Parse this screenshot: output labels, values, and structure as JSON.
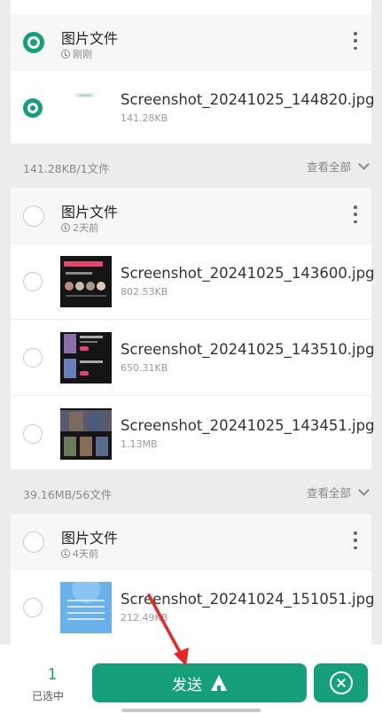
{
  "colors": {
    "accent": "#159f7b",
    "arrow": "#e8262a"
  },
  "groups": [
    {
      "title": "图片文件",
      "time": "刚刚",
      "checked": true,
      "files": [
        {
          "name": "Screenshot_20241025_144820.jpg",
          "size": "141.28KB",
          "checked": true
        }
      ],
      "summary": {
        "stats": "141.28KB/1文件",
        "view_all": "查看全部"
      }
    },
    {
      "title": "图片文件",
      "time": "2天前",
      "checked": false,
      "files": [
        {
          "name": "Screenshot_20241025_143600.jpg",
          "size": "802.53KB",
          "checked": false
        },
        {
          "name": "Screenshot_20241025_143510.jpg",
          "size": "650.31KB",
          "checked": false
        },
        {
          "name": "Screenshot_20241025_143451.jpg",
          "size": "1.13MB",
          "checked": false
        }
      ],
      "summary": {
        "stats": "39.16MB/56文件",
        "view_all": "查看全部"
      }
    },
    {
      "title": "图片文件",
      "time": "4天前",
      "checked": false,
      "files": [
        {
          "name": "Screenshot_20241024_151051.jpg",
          "size": "212.49KB",
          "checked": false
        }
      ]
    }
  ],
  "bottom_bar": {
    "selected_count": "1",
    "selected_label": "已选中",
    "send_label": "发送"
  },
  "icons": [
    "clock-icon",
    "more-vert-icon",
    "chevron-down-icon",
    "send-icon",
    "close-circle-icon",
    "checkbox-icon"
  ]
}
